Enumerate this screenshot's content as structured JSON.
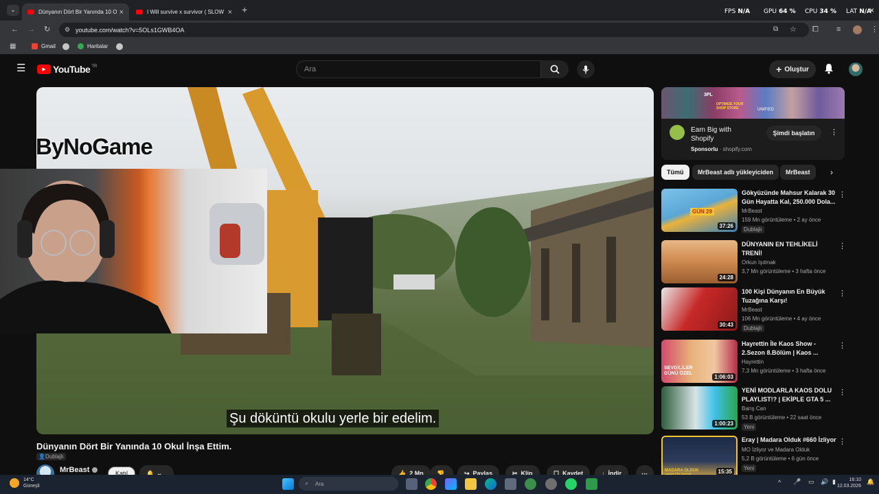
{
  "browser": {
    "tabs": [
      {
        "title": "Dünyanın Dört Bir Yanında 10 O",
        "active": true
      },
      {
        "title": "I Will survive x survivor ( SLOW",
        "active": false
      }
    ],
    "new_tab": "+",
    "overlay_stats": {
      "fps_label": "FPS",
      "fps_value": "N/A",
      "gpu_label": "GPU",
      "gpu_value": "64 %",
      "cpu_label": "CPU",
      "cpu_value": "34 %",
      "lat_label": "LAT",
      "lat_value": "N/A"
    },
    "url": "youtube.com/watch?v=5OLs1GWB4OA",
    "bookmarks": [
      "Gmail",
      "Haritalar"
    ]
  },
  "youtube": {
    "logo_text": "YouTube",
    "country_code": "TR",
    "search_placeholder": "Ara",
    "create_label": "Oluştur",
    "streamer_overlay": "ByNoGame",
    "subtitle": "Şu döküntü okulu yerle bir edelim.",
    "video_title": "Dünyanın Dört Bir Yanında 10 Okul İnşa Ettim.",
    "dubbed_label": "Dublajlı",
    "channel": "MrBeast",
    "join_label": "Katıl",
    "actions": {
      "likes": "2 Mn",
      "share": "Paylaş",
      "clip": "Klip",
      "save": "Kaydet",
      "download": "İndir"
    }
  },
  "sidebar": {
    "ad": {
      "title": "Earn Big with Shopify",
      "sponsor_label": "Sponsorlu",
      "domain": "shopify.com",
      "cta": "Şimdi başlatın",
      "banner_text_1": "3PL",
      "banner_text_2": "OPTIMIZE YOUR SHOP STORE",
      "banner_text_3": "UNIFIED"
    },
    "chips": [
      "Tümü",
      "MrBeast adlı yükleyiciden",
      "MrBeast"
    ],
    "recommendations": [
      {
        "title": "Gökyüzünde Mahsur Kalarak 30 Gün Hayatta Kal, 250.000 Dola...",
        "channel": "MrBeast",
        "meta": "159 Mn görüntüleme • 2 ay önce",
        "badge": "Dublajlı",
        "duration": "37:26",
        "thumb_text": "GÜN 29"
      },
      {
        "title": "DÜNYANIN EN TEHLİKELİ TRENİ!",
        "channel": "Orkun Işıtmak",
        "meta": "3,7 Mn görüntüleme • 3 hafta önce",
        "badge": "",
        "duration": "24:28",
        "thumb_text": ""
      },
      {
        "title": "100 Kişi Dünyanın En Büyük Tuzağına Karşı!",
        "channel": "MrBeast",
        "meta": "106 Mn görüntüleme • 4 ay önce",
        "badge": "Dublajlı",
        "duration": "30:43",
        "thumb_text": ""
      },
      {
        "title": "Hayrettin İle Kaos Show - 2.Sezon 8.Bölüm | Kaos ...",
        "channel": "Hayrettin",
        "meta": "7,3 Mn görüntüleme • 3 hafta önce",
        "badge": "",
        "duration": "1:06:03",
        "thumb_text": "SEVGİLİLER GÜNÜ ÖZEL"
      },
      {
        "title": "YENİ MODLARLA KAOS DOLU PLAYLIST!? | EKİPLE GTA 5 ...",
        "channel": "Barış Can",
        "meta": "53 B görüntüleme • 22 saat önce",
        "badge": "Yeni",
        "duration": "1:00:23",
        "thumb_text": ""
      },
      {
        "title": "Eray | Madara Olduk #660 İzliyor",
        "channel": "MO İzliyor ve Madara Olduk",
        "meta": "5,2 B görüntüleme • 6 gün önce",
        "badge": "Yeni",
        "duration": "15:35",
        "thumb_text": "MADARA OLDUK #660 İZLİYOR"
      }
    ]
  },
  "taskbar": {
    "weather_temp": "14°C",
    "weather_text": "Güneşli",
    "search_placeholder": "Ara",
    "time": "16:10",
    "date": "12.03.2026"
  }
}
